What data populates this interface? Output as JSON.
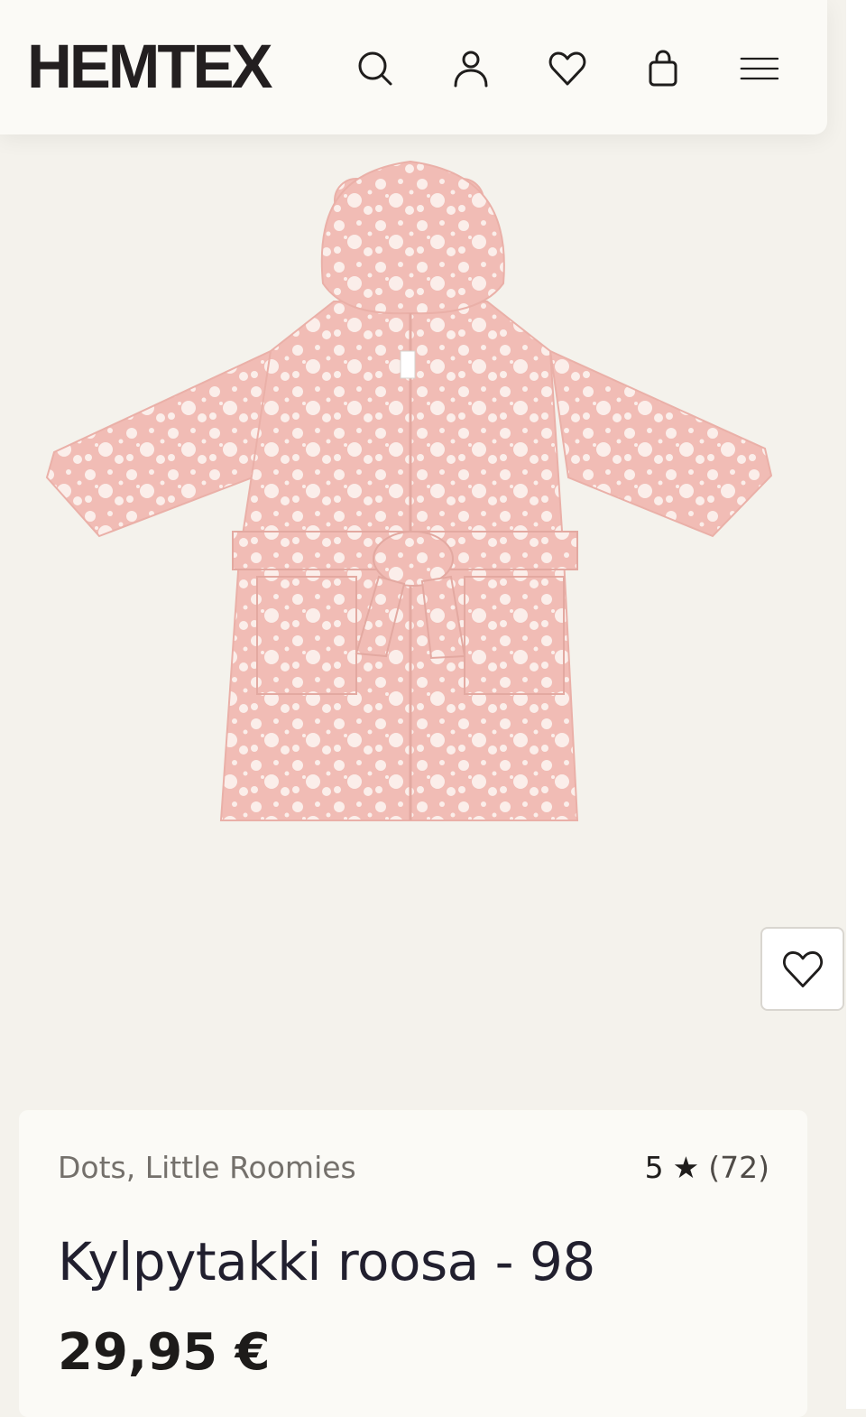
{
  "header": {
    "logo": "HEMTEX",
    "icons": [
      "search-icon",
      "account-icon",
      "wishlist-icon",
      "cart-bag-icon",
      "menu-icon"
    ]
  },
  "product": {
    "image_alt": "Kylpytakki roosa",
    "wishlist_icon": "heart-outline-icon",
    "brand": "Dots, Little Roomies",
    "rating": {
      "score": "5",
      "star": "★",
      "count": "(72)"
    },
    "title": "Kylpytakki roosa - 98",
    "price": "29,95 €"
  },
  "colors": {
    "page_bg": "#f4f2ec",
    "header_bg": "#fbfaf6",
    "robe_pink": "#f1bcb5",
    "robe_dots": "#fbeeea",
    "text_dark": "#1f1d1c",
    "text_muted": "#74706b"
  }
}
